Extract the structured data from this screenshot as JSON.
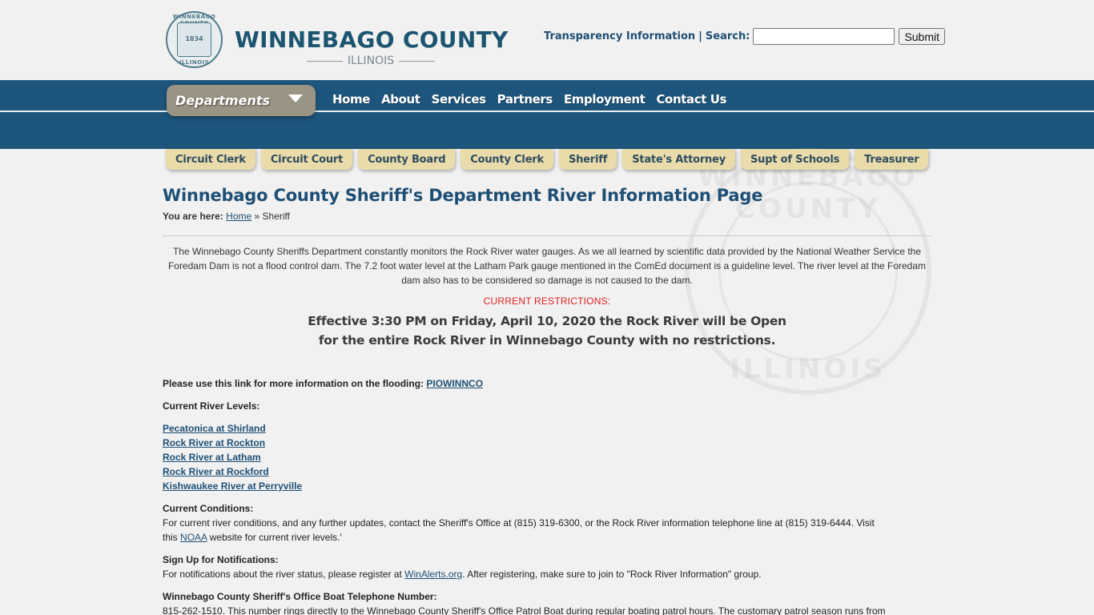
{
  "header": {
    "logo": {
      "seal_ring_top": "WINNEBAGO COUNTY",
      "seal_year": "1834",
      "seal_ring_bottom": "ILLINOIS",
      "title": "WINNEBAGO COUNTY",
      "subtitle": "ILLINOIS"
    },
    "transparency_link": "Transparency Information",
    "separator": "|",
    "search_label": "Search:",
    "search_value": "",
    "search_placeholder": "",
    "submit_label": "Submit"
  },
  "nav": {
    "departments_label": "Departments",
    "items": [
      {
        "label": "Home"
      },
      {
        "label": "About"
      },
      {
        "label": "Services"
      },
      {
        "label": "Partners"
      },
      {
        "label": "Employment"
      },
      {
        "label": "Contact Us"
      }
    ]
  },
  "dept_tabs": [
    {
      "label": "Circuit Clerk"
    },
    {
      "label": "Circuit Court"
    },
    {
      "label": "County Board"
    },
    {
      "label": "County Clerk"
    },
    {
      "label": "Sheriff"
    },
    {
      "label": "State's Attorney"
    },
    {
      "label": "Supt of Schools"
    },
    {
      "label": "Treasurer"
    }
  ],
  "watermark": {
    "top_text": "WINNEBAGO COUNTY",
    "bottom_text": "ILLINOIS"
  },
  "page": {
    "title": "Winnebago County Sheriff's Department River Information Page",
    "breadcrumb": {
      "prefix": "You are here:",
      "home": "Home",
      "separator": "»",
      "current": "Sheriff"
    },
    "intro": "The Winnebago County Sheriffs Department constantly monitors the Rock River water gauges. As we all learned by scientific data provided by the National Weather Service the Foredam Dam is not a flood control dam.  The 7.2 foot water level at the Latham Park gauge mentioned in the ComEd document is a guideline level. The river level at the Foredam dam also has to be considered so damage is not caused to the dam.",
    "restrictions_label": "CURRENT RESTRICTIONS:",
    "announcement_line1": "Effective 3:30 PM on Friday, April 10, 2020 the Rock River will be Open",
    "announcement_line2": "for the entire Rock River in Winnebago County with no restrictions.",
    "flood_info_text": "Please use this link for more information on the flooding:",
    "flood_info_link": "PIOWINNCO",
    "river_levels_heading": "Current River Levels:",
    "river_levels": [
      {
        "label": "Pecatonica at Shirland"
      },
      {
        "label": "Rock River at Rockton"
      },
      {
        "label": "Rock River at Latham"
      },
      {
        "label": "Rock River at Rockford"
      },
      {
        "label": "Kishwaukee River at Perryville"
      }
    ],
    "conditions_heading": "Current Conditions:",
    "conditions_text_1": "For current river conditions, and any further updates, contact the Sheriff's Office at (815) 319-6300, or the Rock River information telephone line at (815) 319-6444. Visit this",
    "conditions_link": "NOAA",
    "conditions_text_2": "website for current river levels.'",
    "signup_heading": "Sign Up for Notifications:",
    "signup_text_1": "For notifications about the river status, please register at",
    "signup_link": "WinAlerts.org",
    "signup_text_2": ". After registering, make sure to join to \"Rock River Information\" group.",
    "boat_heading": "Winnebago County Sheriff's Office Boat Telephone Number:",
    "boat_text": "815-262-1510.  This number rings directly to the Winnebago County Sheriff's Office Patrol Boat during regular boating patrol hours.  The customary patrol season runs from"
  }
}
